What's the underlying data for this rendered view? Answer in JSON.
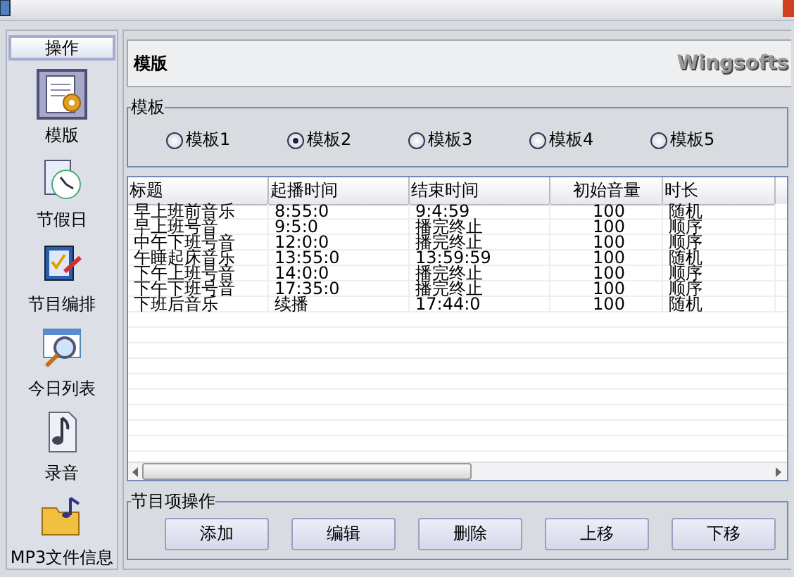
{
  "sidebar": {
    "header": "操作",
    "items": [
      {
        "label": "模版",
        "kind": "notepad",
        "selected": true
      },
      {
        "label": "节假日",
        "kind": "clock",
        "selected": false
      },
      {
        "label": "节目编排",
        "kind": "check",
        "selected": false
      },
      {
        "label": "今日列表",
        "kind": "search",
        "selected": false
      },
      {
        "label": "录音",
        "kind": "music",
        "selected": false
      },
      {
        "label": "MP3文件信息",
        "kind": "folder",
        "selected": false
      }
    ]
  },
  "panel": {
    "title": "模版",
    "logo": "Wingsofts"
  },
  "template_group": {
    "legend": "模板",
    "options": [
      {
        "label": "模板1",
        "selected": false
      },
      {
        "label": "模板2",
        "selected": true
      },
      {
        "label": "模板3",
        "selected": false
      },
      {
        "label": "模板4",
        "selected": false
      },
      {
        "label": "模板5",
        "selected": false
      }
    ]
  },
  "table": {
    "columns": [
      "标题",
      "起播时间",
      "结束时间",
      "初始音量",
      "时长"
    ],
    "rows": [
      [
        "早上班前音乐",
        "8:55:0",
        "9:4:59",
        "100",
        "随机"
      ],
      [
        "早上班号音",
        "9:5:0",
        "播完终止",
        "100",
        "顺序"
      ],
      [
        "中午下班号音",
        "12:0:0",
        "播完终止",
        "100",
        "顺序"
      ],
      [
        "午睡起床音乐",
        "13:55:0",
        "13:59:59",
        "100",
        "随机"
      ],
      [
        "下午上班号音",
        "14:0:0",
        "播完终止",
        "100",
        "顺序"
      ],
      [
        "下午下班号音",
        "17:35:0",
        "播完终止",
        "100",
        "顺序"
      ],
      [
        "下班后音乐",
        "续播",
        "17:44:0",
        "100",
        "随机"
      ]
    ]
  },
  "actions": {
    "legend": "节目项操作",
    "buttons": [
      "添加",
      "编辑",
      "删除",
      "上移",
      "下移"
    ]
  }
}
